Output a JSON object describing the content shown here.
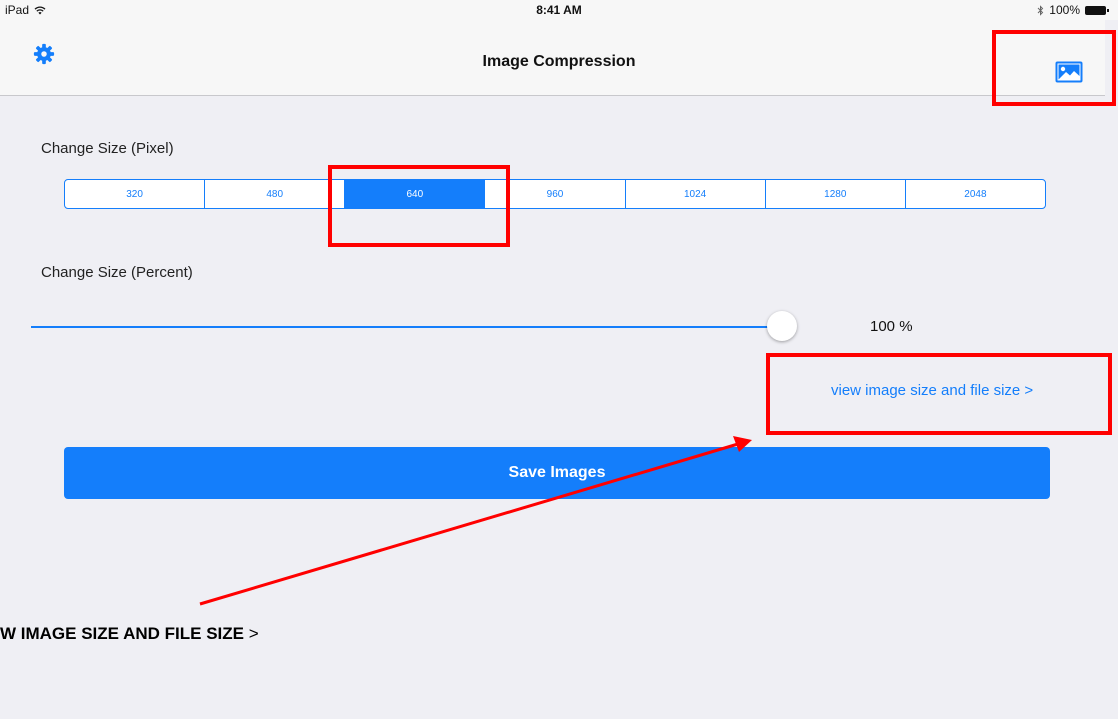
{
  "status_bar": {
    "device": "iPad",
    "time": "8:41 AM",
    "battery": "100%"
  },
  "nav": {
    "title": "Image Compression",
    "left_icon": "gear-icon",
    "right_icon": "photo-icon"
  },
  "pixel_section": {
    "label": "Change Size (Pixel)",
    "options": [
      "320",
      "480",
      "640",
      "960",
      "1024",
      "1280",
      "2048"
    ],
    "selected": "640"
  },
  "percent_section": {
    "label": "Change Size (Percent)",
    "value": 100,
    "value_text": "100 %"
  },
  "view_link": "view image size and file size >",
  "save_button": "Save Images",
  "annotation": {
    "text": "W IMAGE SIZE AND FILE SIZE",
    "chevron": ">"
  },
  "colors": {
    "accent": "#147efb",
    "highlight": "#ff0000",
    "background": "#efeff4"
  }
}
